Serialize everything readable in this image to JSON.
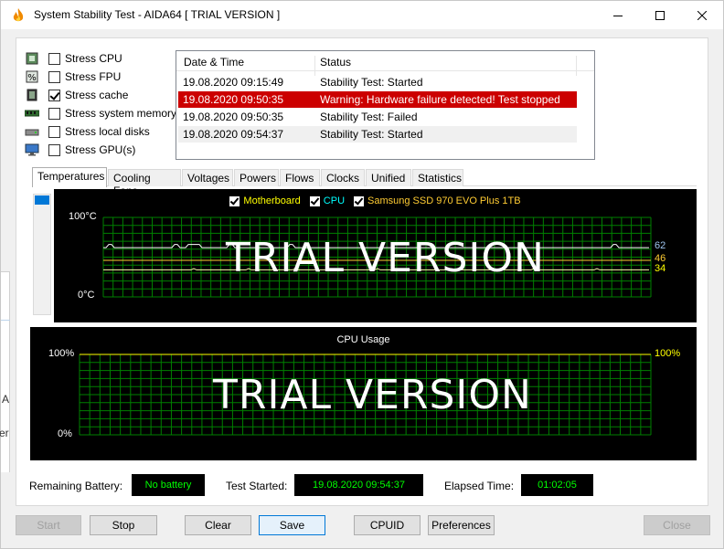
{
  "window": {
    "title": "System Stability Test - AIDA64  [ TRIAL VERSION ]"
  },
  "stress": [
    {
      "label": "Stress CPU",
      "checked": false,
      "icon": "cpu-chip-icon"
    },
    {
      "label": "Stress FPU",
      "checked": false,
      "icon": "fpu-percent-icon"
    },
    {
      "label": "Stress cache",
      "checked": true,
      "icon": "cache-chip-icon"
    },
    {
      "label": "Stress system memory",
      "checked": false,
      "icon": "memory-module-icon"
    },
    {
      "label": "Stress local disks",
      "checked": false,
      "icon": "hard-disk-icon"
    },
    {
      "label": "Stress GPU(s)",
      "checked": false,
      "icon": "monitor-gpu-icon"
    }
  ],
  "log": {
    "headers": {
      "date": "Date & Time",
      "status": "Status"
    },
    "rows": [
      {
        "date": "19.08.2020 09:15:49",
        "status": "Stability Test: Started",
        "style": "normal"
      },
      {
        "date": "19.08.2020 09:50:35",
        "status": "Warning: Hardware failure detected! Test stopped",
        "style": "warn"
      },
      {
        "date": "19.08.2020 09:50:35",
        "status": "Stability Test: Failed",
        "style": "normal"
      },
      {
        "date": "19.08.2020 09:54:37",
        "status": "Stability Test: Started",
        "style": "alt"
      }
    ]
  },
  "tabs": [
    "Temperatures",
    "Cooling Fans",
    "Voltages",
    "Powers",
    "Flows",
    "Clocks",
    "Unified",
    "Statistics"
  ],
  "active_tab": "Temperatures",
  "temp_graph": {
    "legend": [
      {
        "label": "Motherboard",
        "color": "#ffff00"
      },
      {
        "label": "CPU",
        "color": "#00ffff"
      },
      {
        "label": "Samsung SSD 970 EVO Plus 1TB",
        "color": "#ffcc33"
      }
    ],
    "y_max_label": "100°C",
    "y_min_label": "0°C",
    "watermark": "TRIAL VERSION",
    "current_values": [
      {
        "value": "62",
        "color": "#9fc6f0"
      },
      {
        "value": "46",
        "color": "#ffcc33"
      },
      {
        "value": "34",
        "color": "#ffff00"
      }
    ]
  },
  "cpu_graph": {
    "title": "CPU Usage",
    "y_max_label": "100%",
    "y_min_label": "0%",
    "current_value": "100%",
    "current_color": "#ffff00",
    "watermark": "TRIAL VERSION"
  },
  "status": {
    "battery_label": "Remaining Battery:",
    "battery_value": "No battery",
    "started_label": "Test Started:",
    "started_value": "19.08.2020 09:54:37",
    "elapsed_label": "Elapsed Time:",
    "elapsed_value": "01:02:05"
  },
  "buttons": {
    "start": "Start",
    "stop": "Stop",
    "clear": "Clear",
    "save": "Save",
    "cpuid": "CPUID",
    "preferences": "Preferences",
    "close": "Close"
  },
  "edge_fragments": [
    "A",
    "er"
  ],
  "colors": {
    "grid": "#008000",
    "graph_bg": "#000000",
    "warn_row": "#cc0000",
    "status_text": "#00ff00",
    "accent": "#0078d7"
  }
}
